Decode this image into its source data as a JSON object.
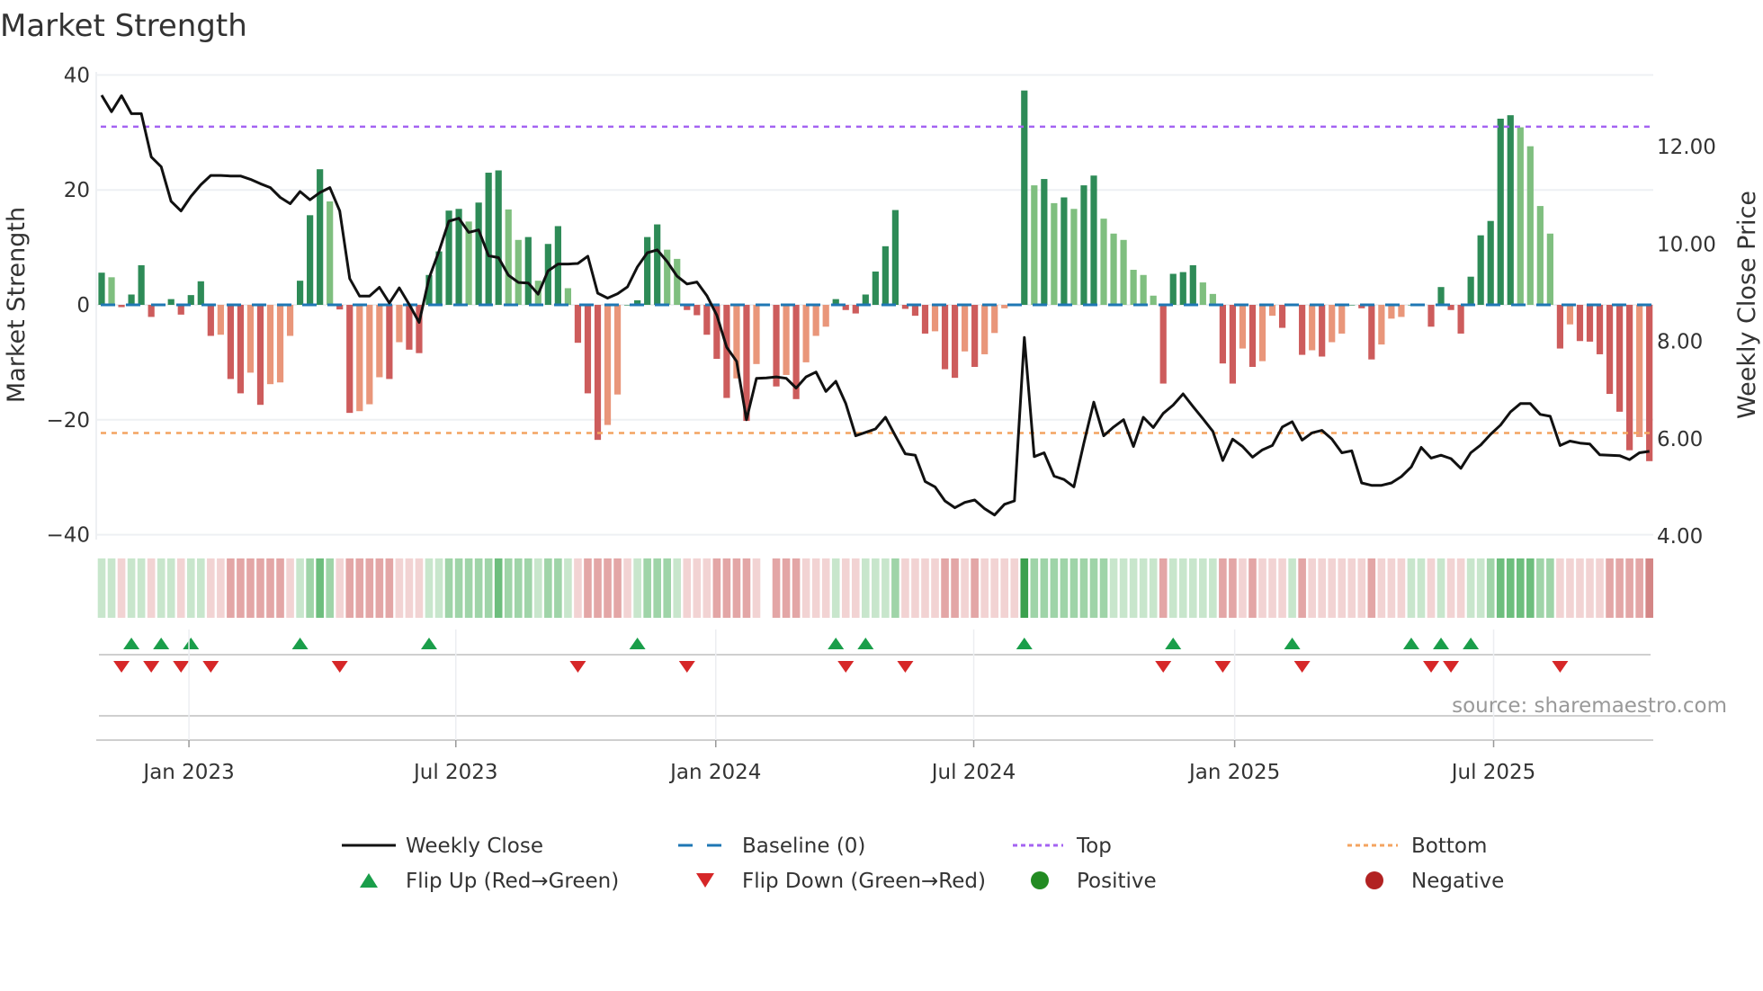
{
  "chart_data": {
    "type": "bar",
    "title": "Market Strength",
    "ylabel": "Market Strength",
    "y2label": "Weekly Close Price",
    "ylim": [
      -40,
      40
    ],
    "y2lim": [
      4,
      12.7
    ],
    "yticks": [
      "40",
      "20",
      "0",
      "−20",
      "−40"
    ],
    "ytick_values": [
      40,
      20,
      0,
      -20,
      -40
    ],
    "y2ticks": [
      "12.00",
      "10.00",
      "8.00",
      "6.00",
      "4.00"
    ],
    "y2tick_values": [
      12,
      10,
      8,
      6,
      4
    ],
    "xticks": [
      {
        "label": "Jan 2023",
        "week": 9.8
      },
      {
        "label": "Jul 2023",
        "week": 36.7
      },
      {
        "label": "Jan 2024",
        "week": 62.9
      },
      {
        "label": "Jul 2024",
        "week": 88.9
      },
      {
        "label": "Jan 2025",
        "week": 115.2
      },
      {
        "label": "Jul 2025",
        "week": 141.3
      }
    ],
    "top_level": 31.0,
    "bottom_level": -22.3,
    "grid": true,
    "strength": [
      5.6,
      4.8,
      -0.4,
      1.8,
      6.9,
      -2.1,
      0.1,
      1.0,
      -1.7,
      1.7,
      4.1,
      -5.4,
      -5.2,
      -12.9,
      -15.4,
      -11.8,
      -17.4,
      -13.8,
      -13.5,
      -5.4,
      4.2,
      15.6,
      23.6,
      18.0,
      -0.8,
      -18.8,
      -18.5,
      -17.3,
      -12.6,
      -12.9,
      -6.5,
      -7.8,
      -8.4,
      5.2,
      9.3,
      16.4,
      16.7,
      14.5,
      17.8,
      23.0,
      23.4,
      16.6,
      11.3,
      11.8,
      4.2,
      10.6,
      13.7,
      2.9,
      -6.6,
      -15.4,
      -23.5,
      -20.9,
      -15.6,
      0,
      0.8,
      11.8,
      14.0,
      9.6,
      8.0,
      -0.9,
      -1.8,
      -5.2,
      -9.4,
      -16.2,
      -12.8,
      -20.2,
      -10.3,
      null,
      -14.2,
      -12.2,
      -16.4,
      -10.0,
      -5.4,
      -3.8,
      1.0,
      -0.9,
      -1.5,
      1.8,
      5.8,
      10.2,
      16.5,
      -0.7,
      -1.9,
      -5.0,
      -4.6,
      -11.2,
      -12.7,
      -8.1,
      -10.8,
      -8.6,
      -4.9,
      -0.6,
      0,
      37.3,
      20.8,
      21.9,
      17.7,
      18.7,
      16.7,
      20.8,
      22.5,
      15.0,
      12.4,
      11.3,
      6.1,
      5.2,
      1.6,
      -13.7,
      5.4,
      5.7,
      6.9,
      3.9,
      1.9,
      -10.2,
      -13.7,
      -7.6,
      -10.8,
      -9.8,
      -1.9,
      -4.0,
      0.2,
      -8.7,
      -7.9,
      -9.0,
      -6.5,
      -5.0,
      0,
      -0.6,
      -9.5,
      -6.9,
      -2.4,
      -2.1,
      0,
      0.2,
      -3.8,
      3.1,
      -0.9,
      -5.0,
      4.9,
      12.1,
      14.6,
      32.4,
      33.0,
      30.9,
      27.6,
      17.2,
      12.4,
      -7.6,
      -3.4,
      -6.3,
      -6.4,
      -8.6,
      -15.5,
      -18.6,
      -25.3,
      -23.0,
      -27.2
    ],
    "weekly_close": [
      13.06,
      12.72,
      13.05,
      12.68,
      12.68,
      11.79,
      11.59,
      10.88,
      10.68,
      10.98,
      11.22,
      11.41,
      11.41,
      11.4,
      11.4,
      11.33,
      11.24,
      11.16,
      10.96,
      10.83,
      11.08,
      10.91,
      11.06,
      11.16,
      10.68,
      9.29,
      8.93,
      8.93,
      9.11,
      8.79,
      9.1,
      8.76,
      8.39,
      9.3,
      9.85,
      10.47,
      10.53,
      10.24,
      10.29,
      9.76,
      9.72,
      9.36,
      9.21,
      9.2,
      8.97,
      9.45,
      9.59,
      9.59,
      9.6,
      9.75,
      8.99,
      8.89,
      8.98,
      9.12,
      9.53,
      9.82,
      9.88,
      9.64,
      9.34,
      9.18,
      9.22,
      8.94,
      8.54,
      7.88,
      7.59,
      6.39,
      7.24,
      7.25,
      7.27,
      7.24,
      7.04,
      7.27,
      7.37,
      6.97,
      7.18,
      6.72,
      6.06,
      6.13,
      6.2,
      6.44,
      6.06,
      5.69,
      5.66,
      5.12,
      5.01,
      4.72,
      4.58,
      4.69,
      4.74,
      4.56,
      4.43,
      4.65,
      4.72,
      8.08,
      5.63,
      5.71,
      5.23,
      5.16,
      5.01,
      5.91,
      6.75,
      6.06,
      6.24,
      6.39,
      5.84,
      6.44,
      6.23,
      6.52,
      6.69,
      6.92,
      6.66,
      6.41,
      6.15,
      5.55,
      5.99,
      5.84,
      5.62,
      5.77,
      5.86,
      6.24,
      6.35,
      5.97,
      6.12,
      6.17,
      5.99,
      5.71,
      5.75,
      5.09,
      5.04,
      5.04,
      5.09,
      5.22,
      5.42,
      5.82,
      5.6,
      5.66,
      5.59,
      5.39,
      5.71,
      5.87,
      6.09,
      6.28,
      6.55,
      6.72,
      6.72,
      6.5,
      6.46,
      5.86,
      5.95,
      5.91,
      5.89,
      5.67,
      5.66,
      5.65,
      5.57,
      5.71,
      5.74
    ],
    "regime_strip": [
      1,
      1,
      -1,
      1,
      1,
      -1,
      1,
      1,
      -1,
      1,
      1,
      -1,
      -1,
      -2,
      -2,
      -2,
      -2,
      -2,
      -2,
      -1,
      1,
      2,
      3,
      2,
      -1,
      -2,
      -2,
      -2,
      -2,
      -2,
      -1,
      -1,
      -1,
      1,
      1,
      2,
      2,
      2,
      2,
      2,
      3,
      2,
      2,
      2,
      1,
      2,
      2,
      1,
      -1,
      -2,
      -2,
      -2,
      -2,
      -1,
      1,
      2,
      2,
      2,
      1,
      -1,
      -1,
      -1,
      -2,
      -2,
      -2,
      -2,
      -1,
      null,
      -2,
      -2,
      -2,
      -1,
      -1,
      -1,
      1,
      -1,
      -1,
      1,
      1,
      1,
      2,
      -1,
      -1,
      -1,
      -1,
      -2,
      -2,
      -1,
      -2,
      -1,
      -1,
      -1,
      -1,
      4,
      2,
      2,
      2,
      2,
      2,
      2,
      2,
      2,
      1,
      1,
      1,
      1,
      1,
      -2,
      1,
      1,
      1,
      1,
      1,
      -2,
      -2,
      -1,
      -2,
      -1,
      -1,
      -1,
      1,
      -2,
      -1,
      -1,
      -1,
      -1,
      -1,
      -1,
      -2,
      -1,
      -1,
      -1,
      1,
      1,
      -1,
      1,
      -1,
      -1,
      1,
      1,
      2,
      3,
      3,
      3,
      3,
      2,
      2,
      -1,
      -1,
      -1,
      -1,
      -1,
      -2,
      -2,
      -2,
      -2,
      -3
    ],
    "flip_up_weeks": [
      4,
      7,
      10,
      21,
      34,
      55,
      75,
      78,
      94,
      109,
      121,
      133,
      136,
      139
    ],
    "flip_down_weeks": [
      3,
      6,
      9,
      12,
      25,
      49,
      60,
      76,
      82,
      108,
      114,
      122,
      135,
      137,
      148
    ],
    "legend": [
      {
        "label": "Weekly Close",
        "kind": "line"
      },
      {
        "label": "Baseline (0)",
        "kind": "dash"
      },
      {
        "label": "Top",
        "kind": "dot-purple"
      },
      {
        "label": "Bottom",
        "kind": "dot-orange"
      },
      {
        "label": "Flip Up (Red→Green)",
        "kind": "tri-up"
      },
      {
        "label": "Flip Down (Green→Red)",
        "kind": "tri-down"
      },
      {
        "label": "Positive",
        "kind": "circle-green"
      },
      {
        "label": "Negative",
        "kind": "circle-red"
      }
    ],
    "legend_position": "bottom",
    "source": "source: sharemaestro.com",
    "colors": {
      "pos_strong": "#2e8b57",
      "pos_weak": "#7fbf7f",
      "neg_strong": "#cd5c5c",
      "neg_weak": "#e9967a",
      "top": "#a463f2",
      "bottom": "#f4a460",
      "baseline": "#1f77b4",
      "price": "#111111",
      "flip_up": "#1a9e4a",
      "flip_down": "#d62728",
      "positive": "#228b22",
      "negative": "#b22222"
    }
  }
}
